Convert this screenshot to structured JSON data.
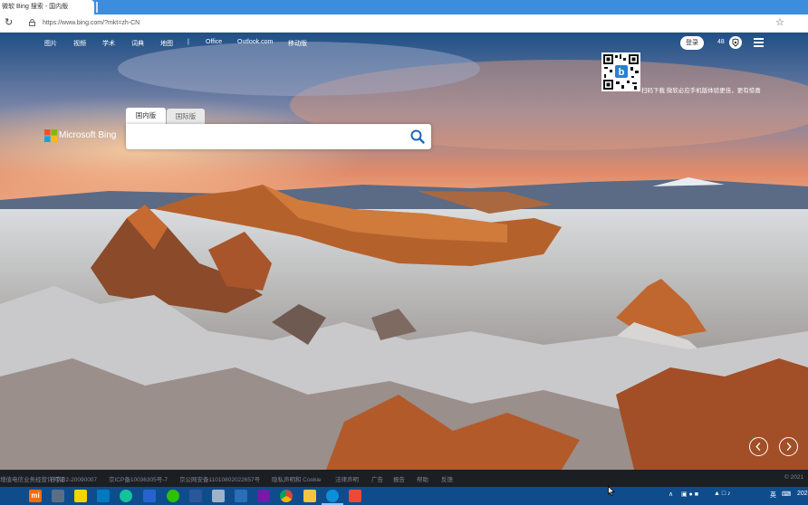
{
  "browser": {
    "tab_title": "微软 Bing 搜索 - 国内版",
    "url": "https://www.bing.com/?mkt=zh-CN"
  },
  "nav": {
    "items": [
      "图片",
      "视频",
      "学术",
      "词典",
      "地图"
    ],
    "separator": "|",
    "links": [
      "Office",
      "Outlook.com",
      "移动版"
    ],
    "login_label": "登录",
    "points": "48"
  },
  "qr": {
    "caption": "扫码下载 微软必应手机版体验更佳，更有惊喜"
  },
  "logo": {
    "text": "Microsoft Bing"
  },
  "search": {
    "tabs": [
      "国内版",
      "国际版"
    ],
    "value": "",
    "placeholder": ""
  },
  "footer": {
    "items": [
      "增值电信业务经营许可证",
      "合字B2-20090007",
      "京ICP备10036305号-7",
      "京公网安备11010802022657号",
      "隐私声明和 Cookie",
      "法律声明",
      "广告",
      "报告",
      "帮助",
      "反馈"
    ],
    "copyright": "© 2021"
  },
  "taskbar": {
    "apps": [
      "mi-icon",
      "calculator-icon",
      "sticky-notes-icon",
      "trello-icon",
      "grammarly-icon",
      "todo-icon",
      "wechat-icon",
      "word-icon",
      "vpn-icon",
      "remote-icon",
      "onenote-icon",
      "chrome-icon",
      "explorer-icon",
      "edge-icon",
      "recorder-icon"
    ],
    "input_method": "英",
    "time": "202"
  },
  "colors": {
    "titlebar": "#3c8dde",
    "taskbar": "#0f4c8c",
    "footer_bg": "#1b1f24",
    "bing_search_icon": "#1d66b6"
  }
}
